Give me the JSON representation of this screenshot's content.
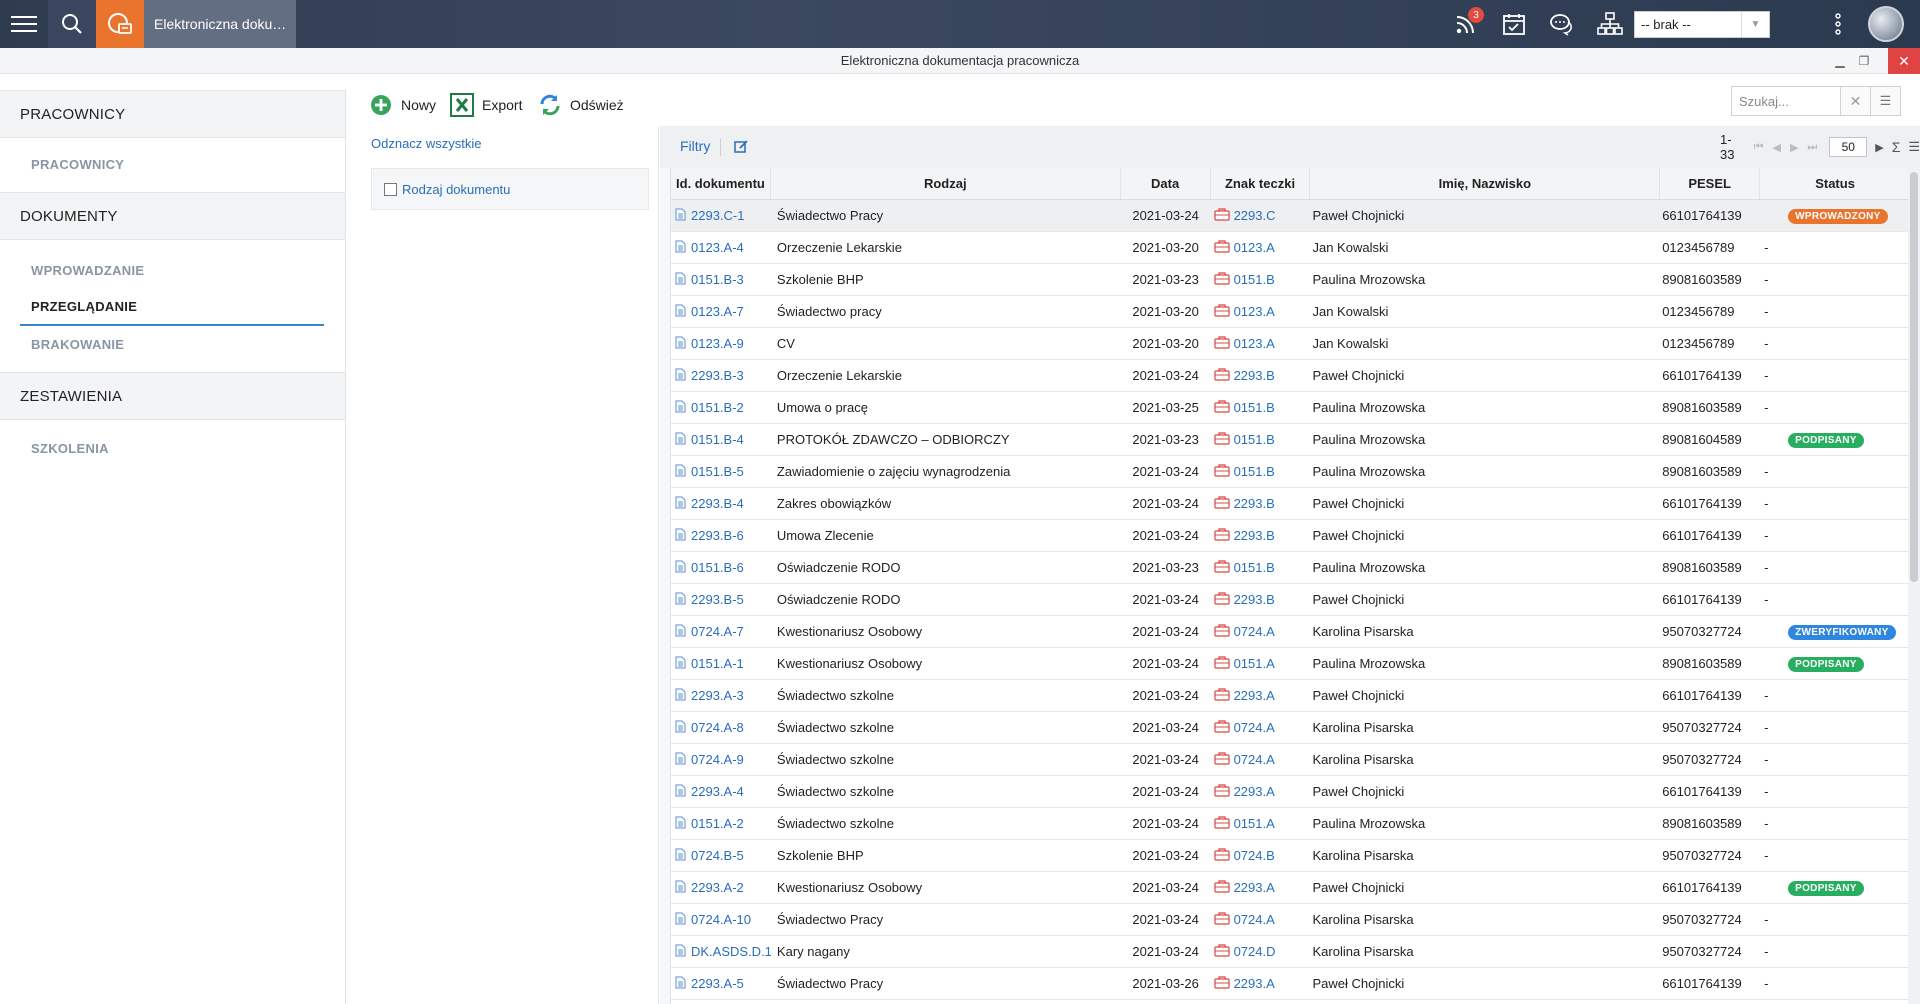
{
  "topbar": {
    "app_title": "Elektroniczna doku…",
    "notifications_count": "3",
    "company_select": "-- brak --"
  },
  "window": {
    "title": "Elektroniczna dokumentacja pracownicza"
  },
  "nav": {
    "section_pracownicy": "PRACOWNICY",
    "item_pracownicy": "PRACOWNICY",
    "section_dokumenty": "DOKUMENTY",
    "item_wprowadzanie": "WPROWADZANIE",
    "item_przegladanie": "PRZEGLĄDANIE",
    "item_brakowanie": "BRAKOWANIE",
    "section_zestawienia": "ZESTAWIENIA",
    "item_szkolenia": "SZKOLENIA"
  },
  "toolbar": {
    "new_label": "Nowy",
    "export_label": "Export",
    "refresh_label": "Odśwież",
    "search_placeholder": "Szukaj..."
  },
  "filters": {
    "unmark_all": "Odznacz wszystkie",
    "doc_type": "Rodzaj dokumentu",
    "label": "Filtry"
  },
  "pager": {
    "range": "1-33",
    "page_size": "50"
  },
  "colors": {
    "accent": "#2a6ebb",
    "app_orange": "#e8742e",
    "status_wprowadzony": "#e8742e",
    "status_podpisany": "#27ae60",
    "status_zweryfikowany": "#2e86de"
  },
  "grid": {
    "columns": [
      "Id. dokumentu",
      "Rodzaj",
      "Data",
      "Znak teczki",
      "Imię, Nazwisko",
      "PESEL",
      "Status"
    ],
    "rows": [
      {
        "id": "2293.C-1",
        "type": "Świadectwo Pracy",
        "date": "2021-03-24",
        "folder": "2293.C",
        "name": "Paweł Chojnicki",
        "pesel": "66101764139",
        "status": "WPROWADZONY",
        "status_color": "#e8742e"
      },
      {
        "id": "0123.A-4",
        "type": "Orzeczenie Lekarskie",
        "date": "2021-03-20",
        "folder": "0123.A",
        "name": "Jan Kowalski",
        "pesel": "0123456789",
        "status": "-"
      },
      {
        "id": "0151.B-3",
        "type": "Szkolenie BHP",
        "date": "2021-03-23",
        "folder": "0151.B",
        "name": "Paulina Mrozowska",
        "pesel": "89081603589",
        "status": "-"
      },
      {
        "id": "0123.A-7",
        "type": "Świadectwo pracy",
        "date": "2021-03-20",
        "folder": "0123.A",
        "name": "Jan Kowalski",
        "pesel": "0123456789",
        "status": "-"
      },
      {
        "id": "0123.A-9",
        "type": "CV",
        "date": "2021-03-20",
        "folder": "0123.A",
        "name": "Jan Kowalski",
        "pesel": "0123456789",
        "status": "-"
      },
      {
        "id": "2293.B-3",
        "type": "Orzeczenie Lekarskie",
        "date": "2021-03-24",
        "folder": "2293.B",
        "name": "Paweł Chojnicki",
        "pesel": "66101764139",
        "status": "-"
      },
      {
        "id": "0151.B-2",
        "type": "Umowa o pracę",
        "date": "2021-03-25",
        "folder": "0151.B",
        "name": "Paulina Mrozowska",
        "pesel": "89081603589",
        "status": "-"
      },
      {
        "id": "0151.B-4",
        "type": "PROTOKÓŁ ZDAWCZO – ODBIORCZY",
        "date": "2021-03-23",
        "folder": "0151.B",
        "name": "Paulina Mrozowska",
        "pesel": "89081604589",
        "status": "PODPISANY",
        "status_color": "#27ae60"
      },
      {
        "id": "0151.B-5",
        "type": "Zawiadomienie o zajęciu wynagrodzenia",
        "date": "2021-03-24",
        "folder": "0151.B",
        "name": "Paulina Mrozowska",
        "pesel": "89081603589",
        "status": "-"
      },
      {
        "id": "2293.B-4",
        "type": "Zakres obowiązków",
        "date": "2021-03-24",
        "folder": "2293.B",
        "name": "Paweł Chojnicki",
        "pesel": "66101764139",
        "status": "-"
      },
      {
        "id": "2293.B-6",
        "type": "Umowa Zlecenie",
        "date": "2021-03-24",
        "folder": "2293.B",
        "name": "Paweł Chojnicki",
        "pesel": "66101764139",
        "status": "-"
      },
      {
        "id": "0151.B-6",
        "type": "Oświadczenie RODO",
        "date": "2021-03-23",
        "folder": "0151.B",
        "name": "Paulina Mrozowska",
        "pesel": "89081603589",
        "status": "-"
      },
      {
        "id": "2293.B-5",
        "type": "Oświadczenie RODO",
        "date": "2021-03-24",
        "folder": "2293.B",
        "name": "Paweł Chojnicki",
        "pesel": "66101764139",
        "status": "-"
      },
      {
        "id": "0724.A-7",
        "type": "Kwestionariusz Osobowy",
        "date": "2021-03-24",
        "folder": "0724.A",
        "name": "Karolina Pisarska",
        "pesel": "95070327724",
        "status": "ZWERYFIKOWANY",
        "status_color": "#2e86de"
      },
      {
        "id": "0151.A-1",
        "type": "Kwestionariusz Osobowy",
        "date": "2021-03-24",
        "folder": "0151.A",
        "name": "Paulina Mrozowska",
        "pesel": "89081603589",
        "status": "PODPISANY",
        "status_color": "#27ae60"
      },
      {
        "id": "2293.A-3",
        "type": "Świadectwo szkolne",
        "date": "2021-03-24",
        "folder": "2293.A",
        "name": "Paweł Chojnicki",
        "pesel": "66101764139",
        "status": "-"
      },
      {
        "id": "0724.A-8",
        "type": "Świadectwo szkolne",
        "date": "2021-03-24",
        "folder": "0724.A",
        "name": "Karolina Pisarska",
        "pesel": "95070327724",
        "status": "-"
      },
      {
        "id": "0724.A-9",
        "type": "Świadectwo szkolne",
        "date": "2021-03-24",
        "folder": "0724.A",
        "name": "Karolina Pisarska",
        "pesel": "95070327724",
        "status": "-"
      },
      {
        "id": "2293.A-4",
        "type": "Świadectwo szkolne",
        "date": "2021-03-24",
        "folder": "2293.A",
        "name": "Paweł Chojnicki",
        "pesel": "66101764139",
        "status": "-"
      },
      {
        "id": "0151.A-2",
        "type": "Świadectwo szkolne",
        "date": "2021-03-24",
        "folder": "0151.A",
        "name": "Paulina Mrozowska",
        "pesel": "89081603589",
        "status": "-"
      },
      {
        "id": "0724.B-5",
        "type": "Szkolenie BHP",
        "date": "2021-03-24",
        "folder": "0724.B",
        "name": "Karolina Pisarska",
        "pesel": "95070327724",
        "status": "-"
      },
      {
        "id": "2293.A-2",
        "type": "Kwestionariusz Osobowy",
        "date": "2021-03-24",
        "folder": "2293.A",
        "name": "Paweł Chojnicki",
        "pesel": "66101764139",
        "status": "PODPISANY",
        "status_color": "#27ae60"
      },
      {
        "id": "0724.A-10",
        "type": "Świadectwo Pracy",
        "date": "2021-03-24",
        "folder": "0724.A",
        "name": "Karolina Pisarska",
        "pesel": "95070327724",
        "status": "-"
      },
      {
        "id": "DK.ASDS.D.1.",
        "type": "Kary nagany",
        "date": "2021-03-24",
        "folder": "0724.D",
        "name": "Karolina Pisarska",
        "pesel": "95070327724",
        "status": "-"
      },
      {
        "id": "2293.A-5",
        "type": "Świadectwo Pracy",
        "date": "2021-03-26",
        "folder": "2293.A",
        "name": "Paweł Chojnicki",
        "pesel": "66101764139",
        "status": "-"
      }
    ]
  }
}
